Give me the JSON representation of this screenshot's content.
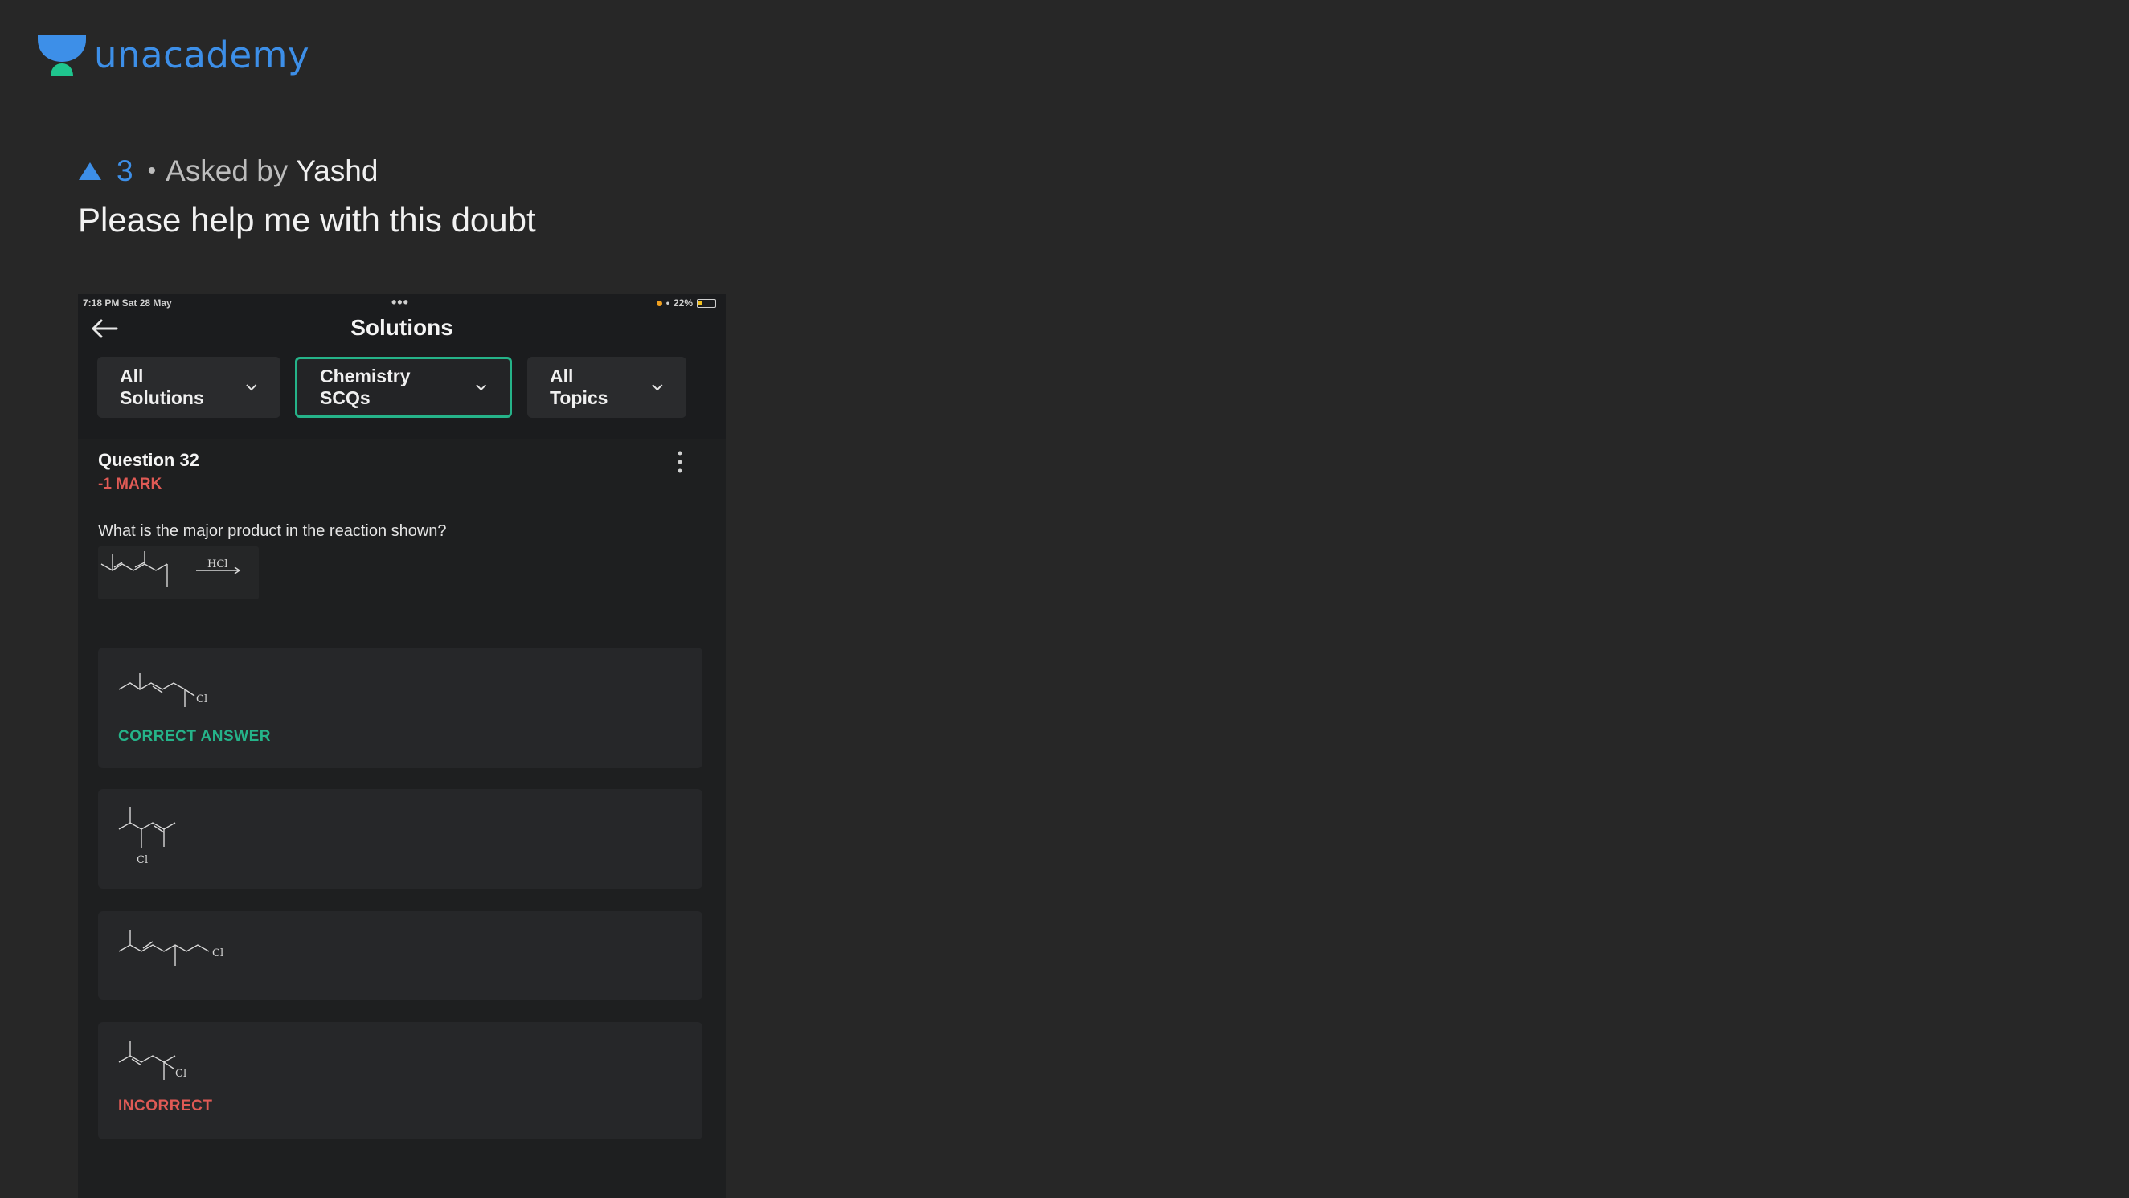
{
  "brand": {
    "name": "unacademy",
    "color": "#3d8fe8",
    "icon": "unacademy-logo-icon"
  },
  "doubt": {
    "upvotes": "3",
    "asked_by_label": "Asked by",
    "asker": "Yashd",
    "title": "Please help me with this doubt"
  },
  "screenshot": {
    "status": {
      "time": "7:18 PM   Sat 28 May",
      "dots": "•••",
      "battery": "22%"
    },
    "title": "Solutions",
    "filters": [
      {
        "label": "All Solutions",
        "active": false
      },
      {
        "label": "Chemistry SCQs",
        "active": true
      },
      {
        "label": "All Topics",
        "active": false
      }
    ],
    "question": {
      "label": "Question 32",
      "marks": "-1 MARK",
      "text": "What is the major product in the reaction shown?",
      "reagent": "HCl"
    },
    "options": [
      {
        "status": "CORRECT ANSWER",
        "status_type": "correct",
        "substituent": "Cl"
      },
      {
        "status": "",
        "status_type": "none",
        "substituent": "Cl"
      },
      {
        "status": "",
        "status_type": "none",
        "substituent": "Cl"
      },
      {
        "status": "INCORRECT",
        "status_type": "incorrect",
        "substituent": "Cl"
      }
    ]
  },
  "colors": {
    "background": "#272727",
    "accent_green": "#25b389",
    "accent_red": "#e05a55"
  }
}
